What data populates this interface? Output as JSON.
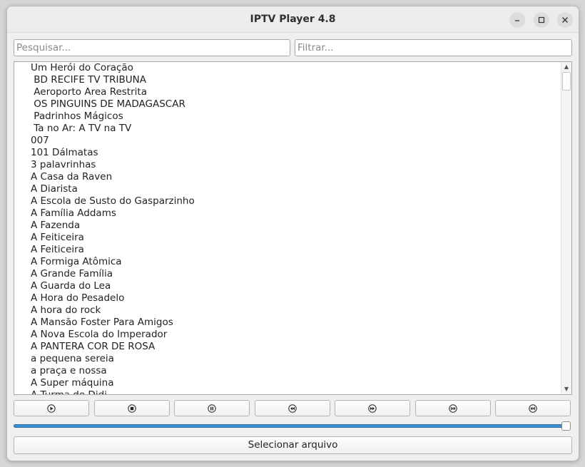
{
  "window": {
    "title": "IPTV Player 4.8"
  },
  "search": {
    "placeholder": "Pesquisar..."
  },
  "filter": {
    "placeholder": "Filtrar..."
  },
  "channels": [
    "Um Herói do Coração",
    " BD RECIFE TV TRIBUNA",
    " Aeroporto Area Restrita",
    " OS PINGUINS DE MADAGASCAR",
    " Padrinhos Mágicos",
    " Ta no Ar: A TV na TV",
    "007",
    "101 Dálmatas",
    "3 palavrinhas",
    "A Casa da Raven",
    "A Diarista",
    "A Escola de Susto do Gasparzinho",
    "A Família Addams",
    "A Fazenda",
    "A Feiticeira",
    "A Feiticeira",
    "A Formiga Atômica",
    "A Grande Família",
    "A Guarda do Lea",
    "A Hora do Pesadelo",
    "A hora do rock",
    "A Mansão Foster Para Amigos",
    "A Nova Escola do Imperador",
    "A PANTERA COR DE ROSA",
    "a pequena sereia",
    "a praça e nossa",
    "A Super máquina",
    "A Turma do Didi"
  ],
  "controls": [
    "play-icon",
    "stop-icon",
    "pause-icon",
    "rewind-icon",
    "fast-forward-icon",
    "skip-back-icon",
    "skip-forward-icon"
  ],
  "progress": {
    "value": 1.0
  },
  "select_file_label": "Selecionar arquivo",
  "colors": {
    "accent": "#3d8fd0"
  }
}
